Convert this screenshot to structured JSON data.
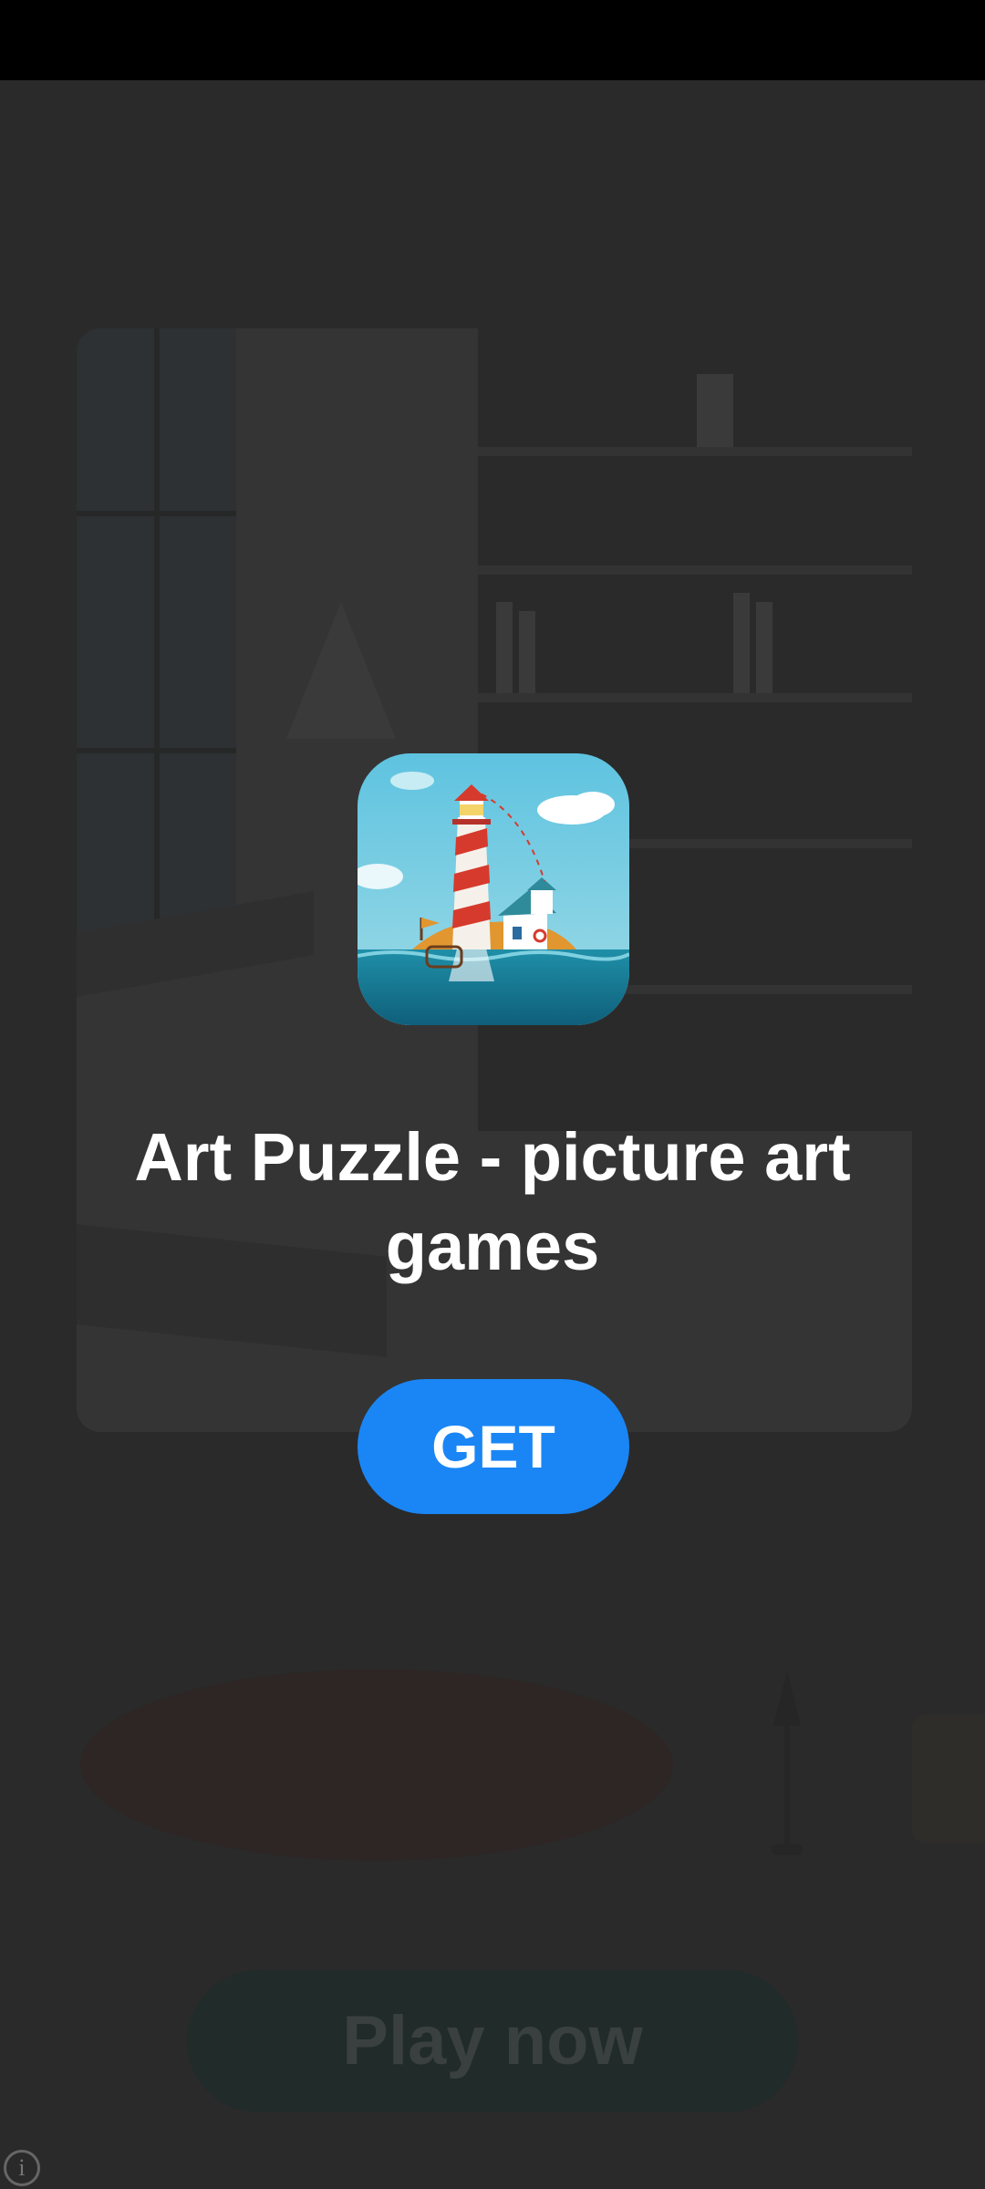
{
  "ad": {
    "app_title": "Art Puzzle - picture art games",
    "get_label": "GET"
  },
  "background": {
    "play_now_label": "Play now"
  },
  "icons": {
    "info": "info-icon",
    "app": "lighthouse-app-icon"
  },
  "colors": {
    "get_button": "#1a86f5",
    "overlay": "#2a2a2a",
    "status_bar": "#000000"
  }
}
